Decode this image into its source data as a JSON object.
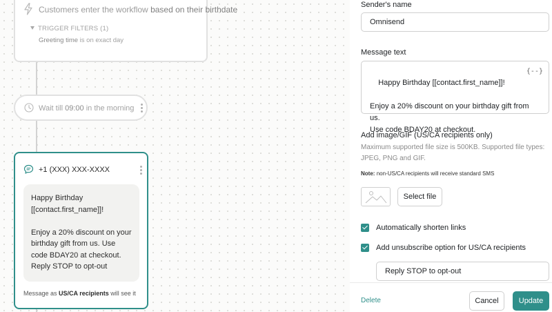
{
  "workflow": {
    "trigger": {
      "title_prefix": "Customers enter the workflow",
      "title_emphasis": "based on their birthdate",
      "filters_label": "TRIGGER FILTERS (1)",
      "filter_field": "Greeting time",
      "filter_condition": "is on exact day"
    },
    "wait": {
      "prefix": "Wait till",
      "time": "09:00",
      "suffix": "in the morning"
    },
    "sms": {
      "phone": "+1 (XXX) XXX-XXXX",
      "preview": "Happy Birthday\n[[contact.first_name]]!\n\nEnjoy a 20% discount on your birthday gift from us. Use code BDAY20 at checkout. Reply STOP to opt-out",
      "footer_prefix": "Message as",
      "footer_audience": "US/CA recipients",
      "footer_suffix": "will see it"
    }
  },
  "panel": {
    "sender_label": "Sender's name",
    "sender_value": "Omnisend",
    "message_label": "Message text",
    "message_value": "Happy Birthday [[contact.first_name]]!\n\nEnjoy a 20% discount on your birthday gift from us.\nUse code BDAY20 at checkout.",
    "variable_icon": "{--}",
    "image_label": "Add image/GIF (US/CA recipients only)",
    "image_hint": "Maximum supported file size is 500KB. Supported file types: JPEG, PNG and GIF.",
    "note_label": "Note:",
    "note_text": "non-US/CA recipients will receive standard SMS",
    "select_file": "Select file",
    "shorten_links_label": "Automatically shorten links",
    "shorten_links_checked": true,
    "unsubscribe_label": "Add unsubscribe option for US/CA recipients",
    "unsubscribe_checked": true,
    "unsubscribe_text": "Reply STOP to opt-out",
    "delete": "Delete",
    "cancel": "Cancel",
    "update": "Update"
  },
  "colors": {
    "accent": "#2f8f8a",
    "canvas_bg": "#fbfbfa",
    "muted_text": "#9b9b9b"
  },
  "icons": [
    "bolt-icon",
    "chevron-down-icon",
    "clock-icon",
    "more-vertical-icon",
    "chat-icon",
    "variable-icon",
    "image-icon",
    "checkmark-icon"
  ]
}
